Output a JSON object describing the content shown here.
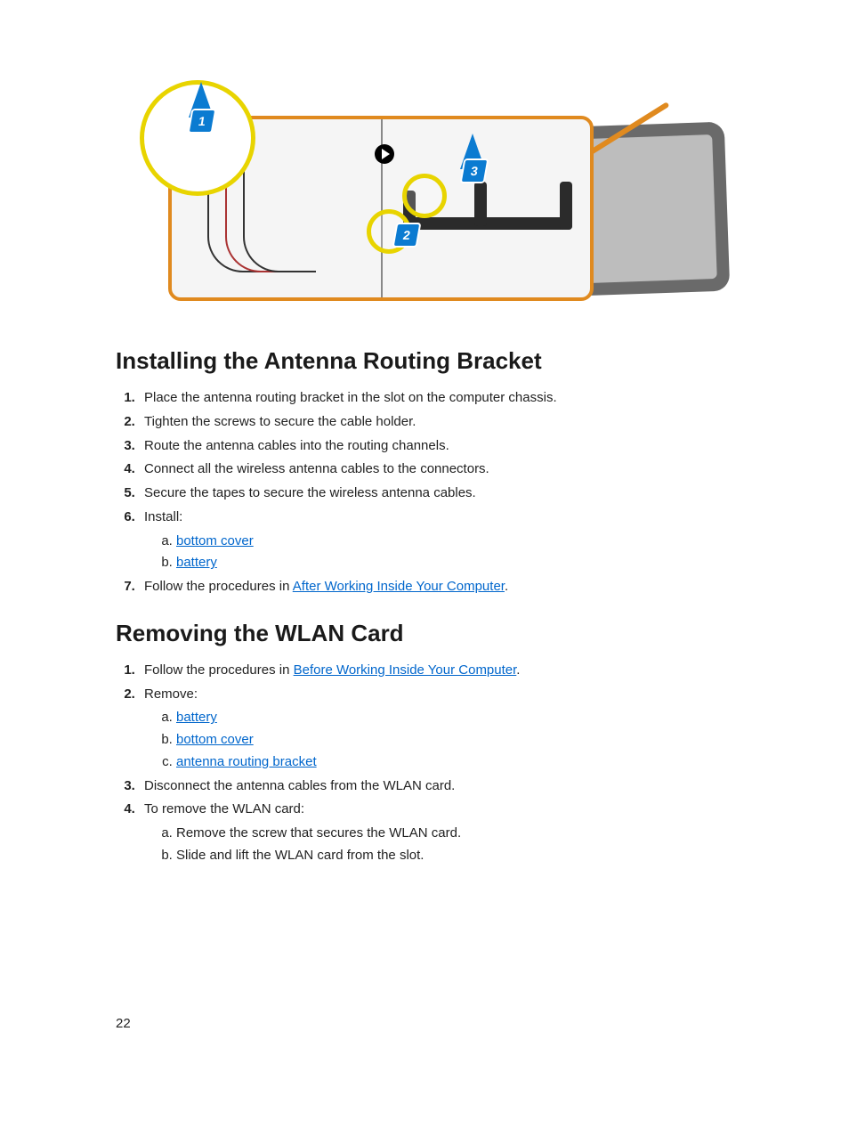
{
  "diagram": {
    "badge1": "1",
    "badge2": "2",
    "badge3": "3"
  },
  "section1": {
    "heading": "Installing the Antenna Routing Bracket",
    "steps": {
      "s1": "Place the antenna routing bracket in the slot on the computer chassis.",
      "s2": "Tighten the screws to secure the cable holder.",
      "s3": "Route the antenna cables into the routing channels.",
      "s4": "Connect all the wireless antenna cables to the connectors.",
      "s5": "Secure the tapes to secure the wireless antenna cables.",
      "s6": "Install:",
      "s6a": "bottom cover",
      "s6b": "battery",
      "s7_pre": "Follow the procedures in ",
      "s7_link": "After Working Inside Your Computer",
      "s7_post": "."
    }
  },
  "section2": {
    "heading": "Removing the WLAN Card",
    "steps": {
      "s1_pre": "Follow the procedures in ",
      "s1_link": "Before Working Inside Your Computer",
      "s1_post": ".",
      "s2": "Remove:",
      "s2a": "battery",
      "s2b": "bottom cover",
      "s2c": "antenna routing bracket",
      "s3": "Disconnect the antenna cables from the WLAN card.",
      "s4": "To remove the WLAN card:",
      "s4a": "Remove the screw that secures the WLAN card.",
      "s4b": "Slide and lift the WLAN card from the slot."
    }
  },
  "page_number": "22"
}
